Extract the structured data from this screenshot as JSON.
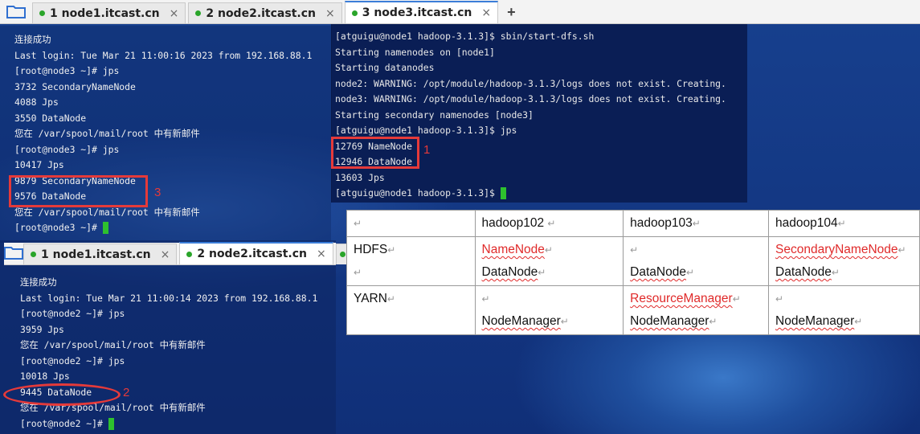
{
  "tabs_top": [
    {
      "label": "1 node1.itcast.cn",
      "active": false
    },
    {
      "label": "2 node2.itcast.cn",
      "active": false
    },
    {
      "label": "3 node3.itcast.cn",
      "active": true
    }
  ],
  "tabs_node2": [
    {
      "label": "1 node1.itcast.cn"
    },
    {
      "label": "2 node2.itcast.cn"
    }
  ],
  "tab_close": "×",
  "tab_add": "+",
  "node3_terminal": [
    "连接成功",
    "Last login: Tue Mar 21 11:00:16 2023 from 192.168.88.1",
    "[root@node3 ~]# jps",
    "3732 SecondaryNameNode",
    "4088 Jps",
    "3550 DataNode",
    "您在 /var/spool/mail/root 中有新邮件",
    "[root@node3 ~]# jps",
    "10417 Jps",
    "9879 SecondaryNameNode",
    "9576 DataNode",
    "您在 /var/spool/mail/root 中有新邮件",
    "[root@node3 ~]# "
  ],
  "node1_terminal": [
    "[atguigu@node1 hadoop-3.1.3]$ sbin/start-dfs.sh",
    "Starting namenodes on [node1]",
    "Starting datanodes",
    "node2: WARNING: /opt/module/hadoop-3.1.3/logs does not exist. Creating.",
    "node3: WARNING: /opt/module/hadoop-3.1.3/logs does not exist. Creating.",
    "Starting secondary namenodes [node3]",
    "[atguigu@node1 hadoop-3.1.3]$ jps",
    "12769 NameNode",
    "12946 DataNode",
    "13603 Jps",
    "[atguigu@node1 hadoop-3.1.3]$ "
  ],
  "node2_terminal": [
    "连接成功",
    "Last login: Tue Mar 21 11:00:14 2023 from 192.168.88.1",
    "[root@node2 ~]# jps",
    "3959 Jps",
    "您在 /var/spool/mail/root 中有新邮件",
    "[root@node2 ~]# jps",
    "10018 Jps",
    "9445 DataNode",
    "您在 /var/spool/mail/root 中有新邮件",
    "[root@node2 ~]# "
  ],
  "annotations": {
    "one": "1",
    "two": "2",
    "three": "3"
  },
  "roles_table": {
    "return_mark": "↵",
    "headers": [
      "hadoop102",
      "hadoop103",
      "hadoop104"
    ],
    "hdfs_label": "HDFS",
    "yarn_label": "YARN",
    "hdfs": {
      "h102_top": "NameNode",
      "h102_bottom": "DataNode",
      "h103_bottom": "DataNode",
      "h104_top": "SecondaryNameNode",
      "h104_bottom": "DataNode"
    },
    "yarn": {
      "h102_bottom": "NodeManager",
      "h103_top": "ResourceManager",
      "h103_bottom": "NodeManager",
      "h104_bottom": "NodeManager"
    }
  },
  "colors": {
    "highlight": "#e53a3a",
    "cursor": "#2ec12e",
    "active_dot": "#2aa52a"
  }
}
